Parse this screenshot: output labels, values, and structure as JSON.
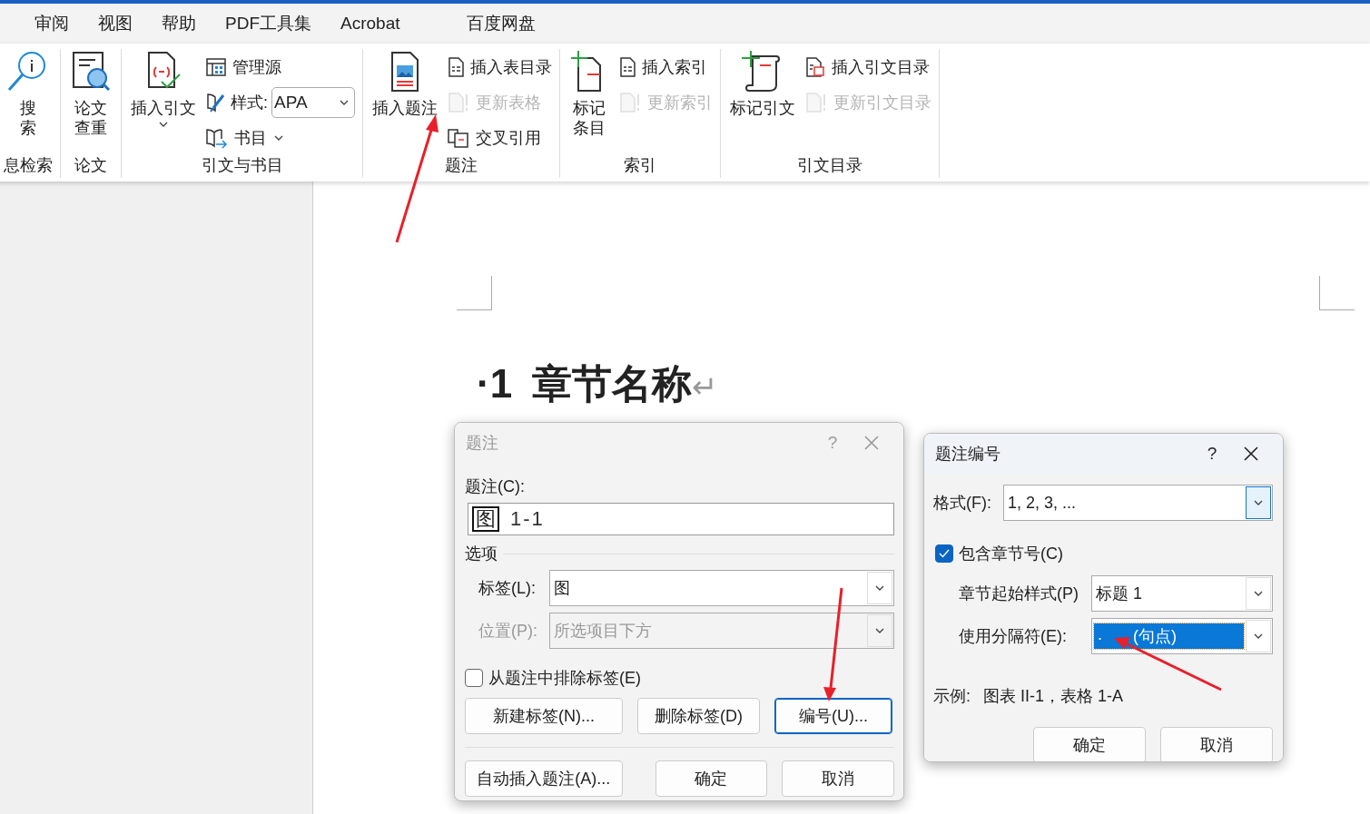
{
  "menu_tabs": [
    {
      "label": "审阅",
      "selected": false
    },
    {
      "label": "视图",
      "selected": false
    },
    {
      "label": "帮助",
      "selected": false
    },
    {
      "label": "PDF工具集",
      "selected": false
    },
    {
      "label": "Acrobat",
      "selected": false
    },
    {
      "label": "百度网盘",
      "selected": false
    }
  ],
  "ribbon": {
    "groups": [
      {
        "label": "息检索",
        "large": [
          {
            "kind": "search",
            "lines": [
              "搜",
              "索"
            ],
            "caret": false
          }
        ]
      },
      {
        "label": "论文",
        "large": [
          {
            "kind": "doc_search",
            "lines": [
              "论文",
              "查重"
            ],
            "caret": false
          }
        ]
      },
      {
        "label": "引文与书目",
        "large": [
          {
            "kind": "citation",
            "lines": [
              "插入引文"
            ],
            "caret": true
          }
        ],
        "small": [
          {
            "kind": "sources",
            "label": "管理源",
            "disabled": false,
            "caret": false
          },
          {
            "kind": "style",
            "label": "样式:",
            "value": "APA",
            "disabled": false
          },
          {
            "kind": "book",
            "label": "书目",
            "disabled": false,
            "caret": true
          }
        ]
      },
      {
        "label": "题注",
        "large": [
          {
            "kind": "caption",
            "lines": [
              "插入题注"
            ],
            "caret": false
          }
        ],
        "small": [
          {
            "kind": "list_doc",
            "label": "插入表目录",
            "disabled": false,
            "caret": false
          },
          {
            "kind": "update",
            "label": "更新表格",
            "disabled": true,
            "caret": false
          },
          {
            "kind": "cross_ref",
            "label": "交叉引用",
            "disabled": false,
            "caret": false
          }
        ]
      },
      {
        "label": "索引",
        "large": [
          {
            "kind": "mark_entry",
            "lines": [
              "标记",
              "条目"
            ],
            "caret": false
          }
        ],
        "small": [
          {
            "kind": "list_doc",
            "label": "插入索引",
            "disabled": false,
            "caret": false
          },
          {
            "kind": "update",
            "label": "更新索引",
            "disabled": true,
            "caret": false
          }
        ]
      },
      {
        "label": "引文目录",
        "large": [
          {
            "kind": "mark_citation",
            "lines": [
              "标记引文"
            ],
            "caret": false
          }
        ],
        "small": [
          {
            "kind": "citation_doc",
            "label": "插入引文目录",
            "disabled": false,
            "caret": false
          },
          {
            "kind": "update",
            "label": "更新引文目录",
            "disabled": true,
            "caret": false
          }
        ]
      }
    ]
  },
  "document": {
    "heading_number": "·1",
    "heading_text": "章节名称",
    "paragraph_mark": "↵"
  },
  "caption_dialog": {
    "title": "题注",
    "active": false,
    "help": "?",
    "caption_label": "题注(C):",
    "caption_field": {
      "label_part": "图",
      "number_part": "1-1"
    },
    "options_heading": "选项",
    "fields": [
      {
        "label": "标签(L):",
        "value": "图",
        "disabled": false
      },
      {
        "label": "位置(P):",
        "value": "所选项目下方",
        "disabled": true
      }
    ],
    "checkbox": {
      "label": "从题注中排除标签(E)",
      "checked": false
    },
    "button_rows": [
      [
        {
          "label": "新建标签(N)...",
          "focused": false
        },
        {
          "label": "删除标签(D)",
          "focused": false
        },
        {
          "label": "编号(U)...",
          "focused": true
        }
      ],
      [
        {
          "label": "自动插入题注(A)...",
          "focused": false
        },
        {
          "label": "确定",
          "focused": false
        },
        {
          "label": "取消",
          "focused": false
        }
      ]
    ]
  },
  "numbering_dialog": {
    "title": "题注编号",
    "active": true,
    "help": "?",
    "format_field": {
      "label": "格式(F):",
      "value": "1, 2, 3, ...",
      "button_highlighted": true
    },
    "checkbox": {
      "label": "包含章节号(C)",
      "checked": true
    },
    "fields": [
      {
        "label": "章节起始样式(P)",
        "value": "标题 1",
        "selected": false
      },
      {
        "label": "使用分隔符(E):",
        "value": ".",
        "value_note": "(句点)",
        "selected": true
      }
    ],
    "example_label": "示例:",
    "example_text": "图表 II-1，表格 1-A",
    "buttons": [
      {
        "label": "确定",
        "focused": false
      },
      {
        "label": "取消",
        "focused": false
      }
    ]
  }
}
